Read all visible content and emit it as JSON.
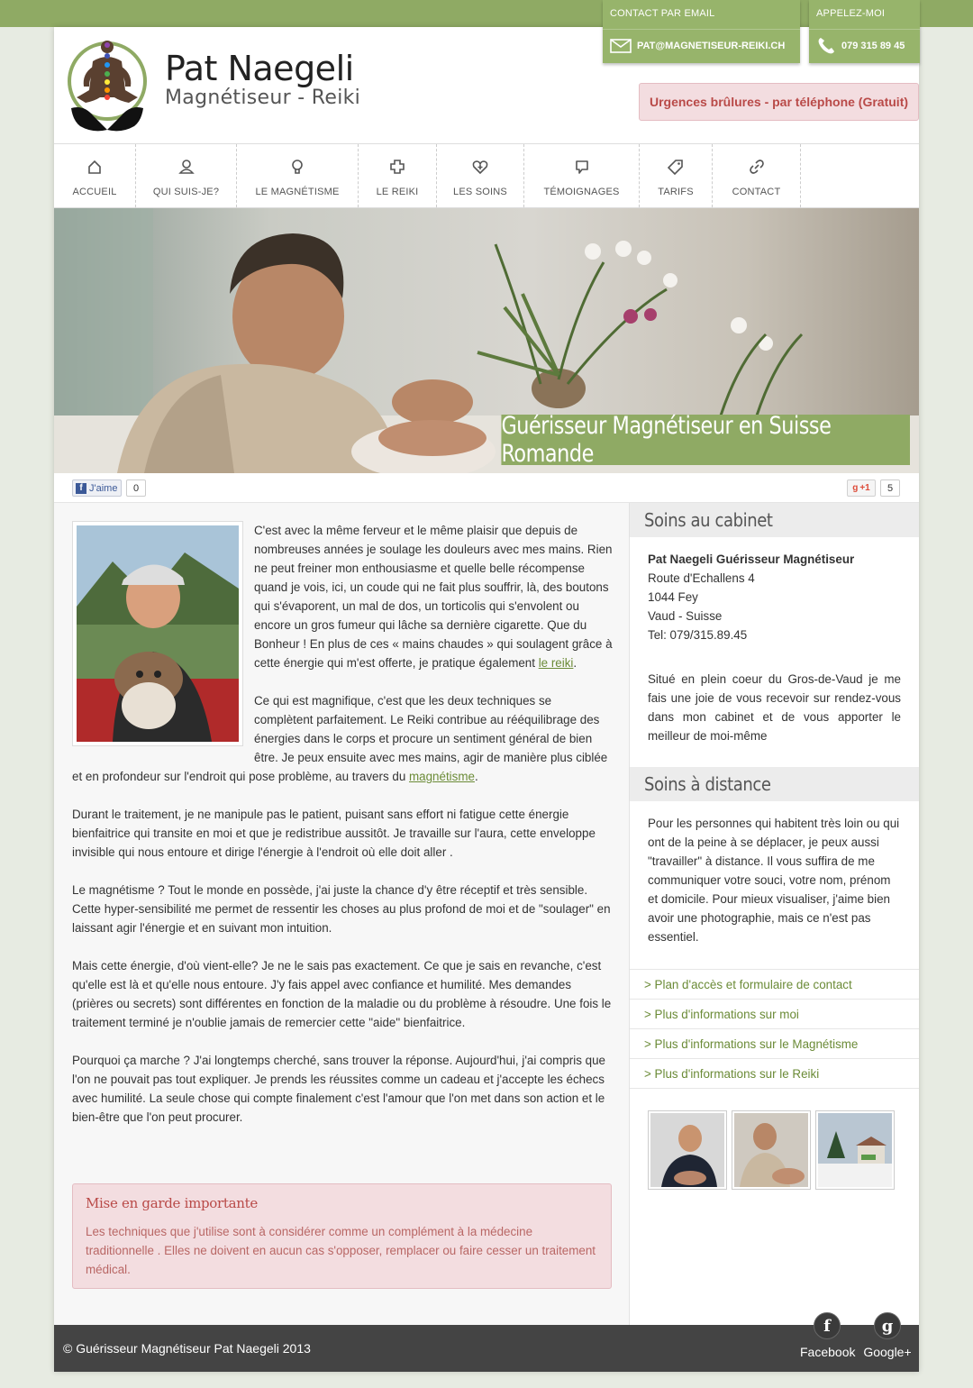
{
  "header": {
    "brand_name": "Pat Naegeli",
    "brand_sub": "Magnétiseur - Reiki",
    "contact_email_title": "CONTACT PAR EMAIL",
    "contact_email": "PAT@MAGNETISEUR-REIKI.CH",
    "contact_phone_title": "APPELEZ-MOI",
    "contact_phone": "079 315 89 45",
    "urgent": "Urgences brûlures - par téléphone (Gratuit)"
  },
  "nav": {
    "items": [
      {
        "label": "ACCUEIL",
        "icon": "home-icon"
      },
      {
        "label": "QUI SUIS-JE?",
        "icon": "user-icon"
      },
      {
        "label": "LE MAGNÉTISME",
        "icon": "lightbulb-icon"
      },
      {
        "label": "LE REIKI",
        "icon": "cross-icon"
      },
      {
        "label": "LES SOINS",
        "icon": "heart-plus-icon"
      },
      {
        "label": "TÉMOIGNAGES",
        "icon": "speech-bubble-icon"
      },
      {
        "label": "TARIFS",
        "icon": "tag-icon"
      },
      {
        "label": "CONTACT",
        "icon": "link-icon"
      }
    ]
  },
  "hero": {
    "caption": "Guérisseur Magnétiseur en Suisse Romande"
  },
  "social": {
    "fb_like_label": "J'aime",
    "fb_count": "0",
    "gplus_label": "+1",
    "gplus_count": "5"
  },
  "main": {
    "p1_start": "C'est avec la même ferveur et le même plaisir que depuis de nombreuses années je soulage les douleurs avec mes mains. Rien ne peut freiner mon enthousiasme et quelle belle récompense quand je vois, ici, un coude qui ne fait plus souffrir, là, des boutons qui s'évaporent, un mal de dos, un torticolis qui s'envolent ou encore un gros fumeur qui lâche sa dernière cigarette. Que du Bonheur ! En plus de ces « mains chaudes » qui soulagent grâce à cette énergie qui m'est offerte, je pratique également ",
    "p1_link": "le reiki",
    "p1_end": ".",
    "p2_start": "Ce qui est magnifique, c'est que les deux techniques se complètent parfaitement. Le Reiki contribue au rééquilibrage des énergies dans le corps et procure un sentiment général de bien être. Je peux ensuite avec mes mains, agir de manière plus ciblée et en profondeur sur l'endroit qui pose problème, au travers du ",
    "p2_link": "magnétisme",
    "p2_end": ".",
    "p3": "Durant le traitement, je ne manipule pas le patient, puisant sans effort ni fatigue cette énergie bienfaitrice qui transite en moi et que je redistribue aussitôt. Je travaille sur l'aura, cette enveloppe invisible qui nous entoure et dirige l'énergie à l'endroit où elle doit aller .",
    "p4": "Le magnétisme ? Tout le monde en possède, j'ai juste la chance d'y être réceptif et très sensible. Cette hyper-sensibilité me permet de ressentir les choses au plus profond de moi et de \"soulager\" en laissant agir l'énergie et en suivant mon intuition.",
    "p5": "Mais cette énergie, d'où vient-elle? Je ne le sais pas exactement. Ce que je sais en revanche, c'est qu'elle est là et qu'elle nous entoure. J'y fais appel avec confiance et humilité. Mes demandes (prières ou secrets) sont différentes en fonction de la maladie ou du problème à résoudre. Une fois le traitement terminé je n'oublie jamais de remercier cette \"aide\" bienfaitrice.",
    "p6": "Pourquoi ça marche ? J'ai longtemps cherché, sans trouver la réponse. Aujourd'hui, j'ai compris que l'on ne pouvait pas tout expliquer. Je prends les réussites comme un cadeau et j'accepte les échecs avec humilité. La seule chose qui compte finalement c'est l'amour que l'on met dans son action et le bien-être que l'on peut procurer.",
    "warning_title": "Mise en garde importante",
    "warning_text": "Les techniques que j'utilise sont à considérer comme un complément à la médecine traditionnelle . Elles ne doivent en aucun cas s'opposer, remplacer ou faire cesser un traitement médical."
  },
  "sidebar": {
    "cabinet_title": "Soins au cabinet",
    "cabinet_name": "Pat Naegeli Guérisseur Magnétiseur",
    "address_line1": "Route d'Echallens 4",
    "address_line2": "1044 Fey",
    "address_line3": "Vaud - Suisse",
    "address_tel": "Tel: 079/315.89.45",
    "cabinet_text": "Situé en plein coeur du Gros-de-Vaud je me fais une joie de vous recevoir sur rendez-vous dans mon cabinet et de vous apporter le meilleur de moi-même",
    "distance_title": "Soins à distance",
    "distance_text": "Pour les personnes qui habitent très loin ou qui ont de la peine à se déplacer, je peux aussi \"travailler\" à distance. Il vous suffira de me communiquer votre souci, votre nom, prénom et domicile. Pour mieux visualiser, j'aime bien avoir une photographie, mais ce n'est pas essentiel.",
    "links": [
      "> Plan d'accès et formulaire de contact",
      "> Plus d'informations sur moi",
      "> Plus d'informations sur le Magnétisme",
      "> Plus d'informations sur le Reiki"
    ]
  },
  "footer": {
    "copyright": "© Guérisseur Magnétiseur Pat Naegeli 2013",
    "facebook": "Facebook",
    "googleplus": "Google+"
  },
  "colors": {
    "accent": "#8faa64",
    "link": "#6b8b37",
    "alert_bg": "#f3dde0",
    "alert_text": "#b94a48",
    "footer": "#444444"
  }
}
